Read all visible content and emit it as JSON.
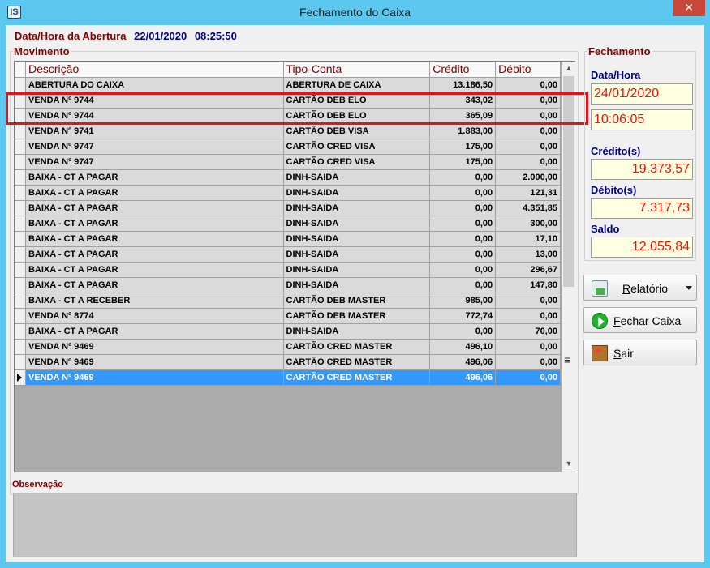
{
  "window": {
    "title": "Fechamento do Caixa",
    "icon_text": "IS",
    "close_label": "✕"
  },
  "opening": {
    "label": "Data/Hora da Abertura",
    "date": "22/01/2020",
    "time": "08:25:50"
  },
  "movimento": {
    "legend": "Movimento",
    "columns": [
      "Descrição",
      "Tipo-Conta",
      "Crédito",
      "Débito"
    ],
    "rows": [
      [
        "ABERTURA DO CAIXA",
        "ABERTURA DE CAIXA",
        "13.186,50",
        "0,00"
      ],
      [
        "VENDA Nº 9744",
        "CARTÃO DEB ELO",
        "343,02",
        "0,00"
      ],
      [
        "VENDA Nº 9744",
        "CARTÃO DEB ELO",
        "365,09",
        "0,00"
      ],
      [
        "VENDA Nº 9741",
        "CARTÃO DEB VISA",
        "1.883,00",
        "0,00"
      ],
      [
        "VENDA Nº 9747",
        "CARTÃO CRED VISA",
        "175,00",
        "0,00"
      ],
      [
        "VENDA Nº 9747",
        "CARTÃO CRED VISA",
        "175,00",
        "0,00"
      ],
      [
        "BAIXA - CT A PAGAR",
        "DINH-SAIDA",
        "0,00",
        "2.000,00"
      ],
      [
        "BAIXA - CT A PAGAR",
        "DINH-SAIDA",
        "0,00",
        "121,31"
      ],
      [
        "BAIXA - CT A PAGAR",
        "DINH-SAIDA",
        "0,00",
        "4.351,85"
      ],
      [
        "BAIXA - CT A PAGAR",
        "DINH-SAIDA",
        "0,00",
        "300,00"
      ],
      [
        "BAIXA - CT A PAGAR",
        "DINH-SAIDA",
        "0,00",
        "17,10"
      ],
      [
        "BAIXA - CT A PAGAR",
        "DINH-SAIDA",
        "0,00",
        "13,00"
      ],
      [
        "BAIXA - CT A PAGAR",
        "DINH-SAIDA",
        "0,00",
        "296,67"
      ],
      [
        "BAIXA - CT A PAGAR",
        "DINH-SAIDA",
        "0,00",
        "147,80"
      ],
      [
        "BAIXA - CT A RECEBER",
        "CARTÃO DEB MASTER",
        "985,00",
        "0,00"
      ],
      [
        "VENDA Nº 8774",
        "CARTÃO DEB MASTER",
        "772,74",
        "0,00"
      ],
      [
        "BAIXA - CT A PAGAR",
        "DINH-SAIDA",
        "0,00",
        "70,00"
      ],
      [
        "VENDA Nº 9469",
        "CARTÃO CRED MASTER",
        "496,10",
        "0,00"
      ],
      [
        "VENDA Nº 9469",
        "CARTÃO CRED MASTER",
        "496,06",
        "0,00"
      ],
      [
        "VENDA Nº 9469",
        "CARTÃO CRED MASTER",
        "496,06",
        "0,00"
      ]
    ],
    "selected_row": 19
  },
  "observacao": {
    "label": "Observação",
    "value": ""
  },
  "fechamento": {
    "legend": "Fechamento",
    "datahora_label": "Data/Hora",
    "date": "24/01/2020",
    "time": "10:06:05",
    "credito_label": "Crédito(s)",
    "credito": "19.373,57",
    "debito_label": "Débito(s)",
    "debito": "7.317,73",
    "saldo_label": "Saldo",
    "saldo": "12.055,84"
  },
  "buttons": {
    "relatorio": "Relatório",
    "fechar": "Fechar Caixa",
    "sair": "Sair"
  },
  "colors": {
    "title_bar": "#5cc8ef",
    "label_red": "#800000",
    "label_blue": "#000080",
    "selected": "#3399ff",
    "highlight": "#e0151b"
  }
}
